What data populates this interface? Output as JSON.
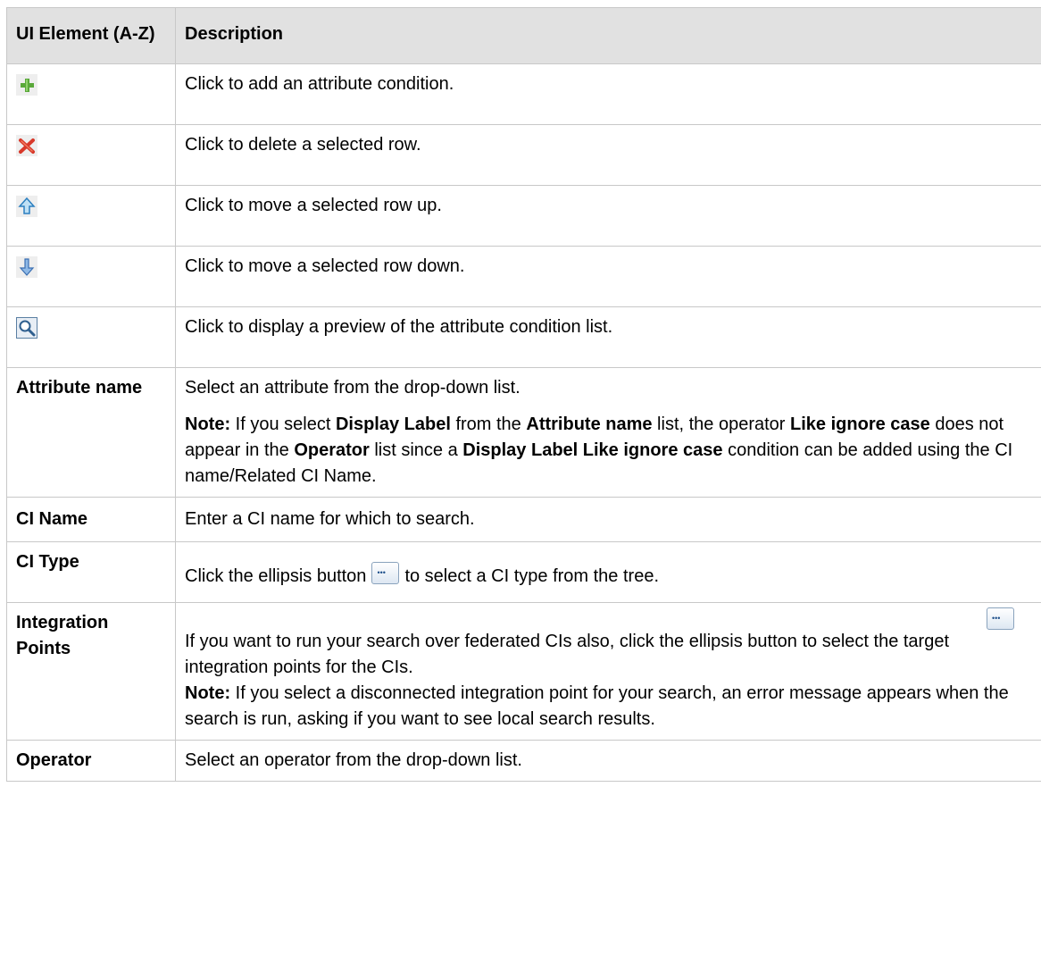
{
  "header": {
    "col1": "UI Element (A-Z)",
    "col2": "Description"
  },
  "icon_rows": [
    {
      "icon": "add-icon",
      "description": "Click to add an attribute condition."
    },
    {
      "icon": "delete-icon",
      "description": "Click to delete a selected row."
    },
    {
      "icon": "move-up-icon",
      "description": "Click to move a selected row up."
    },
    {
      "icon": "move-down-icon",
      "description": "Click to move a selected row down."
    },
    {
      "icon": "preview-icon",
      "description": "Click to display a preview of the attribute condition list."
    }
  ],
  "attribute_name": {
    "element": "Attribute name",
    "description": "Select an attribute from the drop-down list.",
    "note_label": "Note:",
    "note_t1": " If you select ",
    "note_b1": "Display Label",
    "note_t2": " from the ",
    "note_b2": "Attribute name",
    "note_t3": " list, the operator ",
    "note_b3": "Like ignore case",
    "note_t4": " does not appear in the ",
    "note_b4": "Operator",
    "note_t5": " list since a ",
    "note_b5": "Display Label Like ignore case",
    "note_t6": " condition can be added using the CI name/Related CI Name."
  },
  "ci_name": {
    "element": "CI Name",
    "description": "Enter a CI name for which to search."
  },
  "ci_type": {
    "element": "CI Type",
    "desc_before": "Click the ellipsis button",
    "desc_after": "to select a CI type from the tree."
  },
  "integration_points": {
    "element": "Integration Points",
    "desc_before": "If you want to run your search over federated CIs also, click the ellipsis button",
    "desc_after": "to select the target integration points for the CIs.",
    "note_label": "Note:",
    "note_text": " If you select a disconnected integration point for your search, an error message appears when the search is run, asking if you want to see local search results."
  },
  "operator": {
    "element": "Operator",
    "description": "Select an operator from the drop-down list."
  }
}
